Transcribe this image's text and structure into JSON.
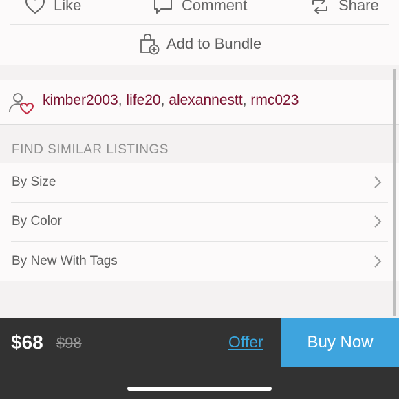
{
  "actions": {
    "like_label": "Like",
    "comment_label": "Comment",
    "share_label": "Share",
    "bundle_label": "Add to Bundle"
  },
  "likers": {
    "users": [
      "kimber2003",
      "life20",
      "alexannestt",
      "rmc023"
    ],
    "separator": ", "
  },
  "similar": {
    "title": "FIND SIMILAR LISTINGS",
    "items": [
      {
        "label": "By Size"
      },
      {
        "label": "By Color"
      },
      {
        "label": "By New With Tags"
      }
    ]
  },
  "purchase": {
    "price": "$68",
    "original_price": "$98",
    "offer_label": "Offer",
    "buy_label": "Buy Now"
  },
  "colors": {
    "accent": "#3ea4de",
    "username": "#7a1230",
    "bottom_bar": "#323232"
  }
}
